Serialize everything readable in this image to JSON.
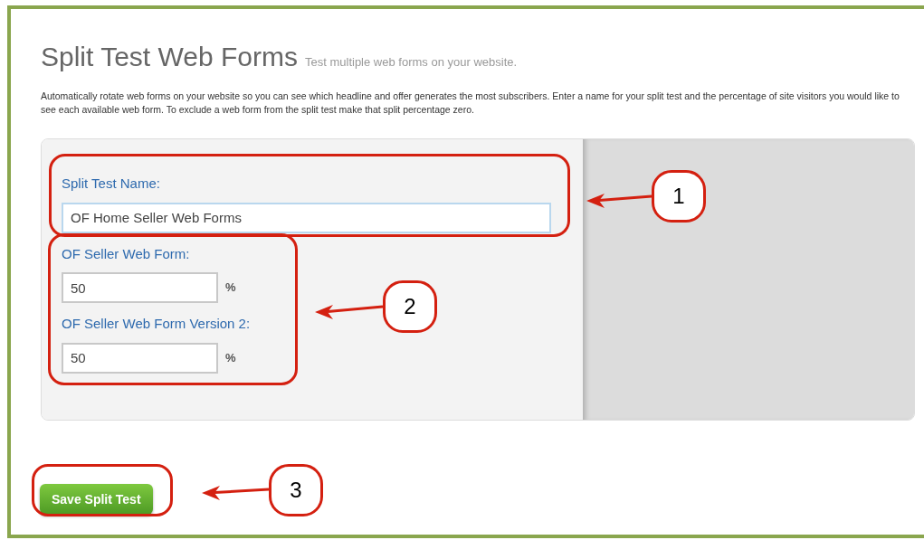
{
  "page": {
    "title": "Split Test Web Forms",
    "subtitle": "Test multiple web forms on your website.",
    "description": "Automatically rotate web forms on your website so you can see which headline and offer generates the most subscribers. Enter a name for your split test and the percentage of site visitors you would like to see each available web form. To exclude a web form from the split test make that split percentage zero."
  },
  "form": {
    "name_field": {
      "label": "Split Test Name:",
      "value": "OF Home Seller Web Forms"
    },
    "split_fields": [
      {
        "label": "OF Seller Web Form:",
        "value": "50",
        "suffix": "%"
      },
      {
        "label": "OF Seller Web Form Version 2:",
        "value": "50",
        "suffix": "%"
      }
    ]
  },
  "button": "Save Split Test",
  "annotations": [
    {
      "number": "1"
    },
    {
      "number": "2"
    },
    {
      "number": "3"
    }
  ]
}
